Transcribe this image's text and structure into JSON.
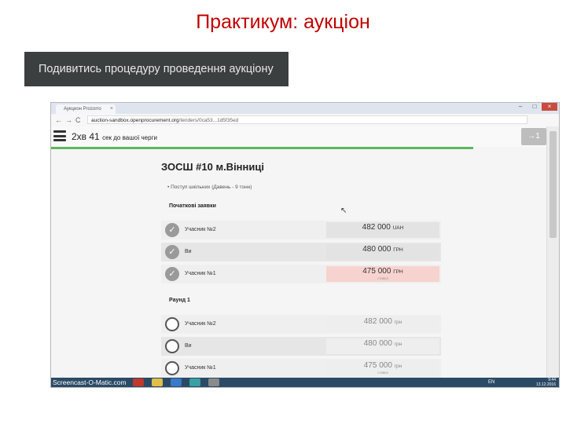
{
  "slide": {
    "title": "Практикум: аукціон",
    "procedure_button": "Подивитись процедуру проведення аукціону"
  },
  "browser": {
    "tab_title": "Аукцион Prozorro",
    "tab_close": "×",
    "minimize": "–",
    "maximize": "□",
    "close": "×",
    "back": "←",
    "forward": "→",
    "reload": "C",
    "url_host": "auction-sandbox.openprocurement.org",
    "url_path": "/tenders/0ca53...1d5f35ed"
  },
  "auction": {
    "countdown": "2хв 41",
    "countdown_suffix": "сек до вашої черги",
    "login_label": "→1",
    "title": "ЗОСШ #10 м.Вінниці",
    "details": "•  Поступ шкільних  (Давень - 9 тонн)",
    "section_initial": "Початкові заявки",
    "section_round": "Раунд 1",
    "initial_bids": [
      {
        "name": "Учасник №2",
        "amount": "482 000",
        "currency": "UAH",
        "note": "",
        "status": "done"
      },
      {
        "name": "Ви",
        "amount": "480 000",
        "currency": "ГРН",
        "note": "",
        "status": "done"
      },
      {
        "name": "Учасник №1",
        "amount": "475 000",
        "currency": "ГРН",
        "note": "ставка",
        "status": "done"
      }
    ],
    "round_bids": [
      {
        "name": "Учасник №2",
        "amount": "482 000",
        "currency": "грн",
        "note": "",
        "status": "pending"
      },
      {
        "name": "Ви",
        "amount": "480 000",
        "currency": "грн",
        "note": "",
        "status": "pending"
      },
      {
        "name": "Учасник №1",
        "amount": "475 000",
        "currency": "грн",
        "note": "ставка",
        "status": "pending"
      }
    ],
    "progress": 0.85
  },
  "taskbar": {
    "brand": "Screencast-O-Matic.com",
    "lang": "EN",
    "time": "9:44",
    "date": "13.12.2016",
    "app_colors": [
      "#c0392b",
      "#e0c04a",
      "#3a78c8",
      "#3aa0a0",
      "#8a8a8a"
    ]
  },
  "colors": {
    "title_red": "#c00000",
    "dark_button": "#3c3f3f",
    "progress_green": "#5cb85c",
    "highlight_pink": "#f7d3d0",
    "taskbar_blue": "#2b4a66"
  }
}
